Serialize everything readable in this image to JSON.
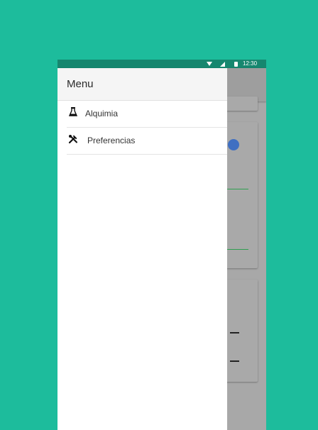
{
  "status_bar": {
    "time": "12:30",
    "wifi_icon": "wifi-icon",
    "signal_icon": "signal-icon",
    "battery_icon": "battery-icon"
  },
  "drawer": {
    "title": "Menu",
    "items": [
      {
        "label": "Alquimia",
        "icon": "flask-icon"
      },
      {
        "label": "Preferencias",
        "icon": "tools-icon"
      }
    ]
  },
  "colors": {
    "background": "#1dbc9c",
    "status_bar": "#16876f",
    "scrim": "#a8a8a8",
    "accent_dot": "#3f6fc2",
    "divider_green": "#2f9e50"
  }
}
